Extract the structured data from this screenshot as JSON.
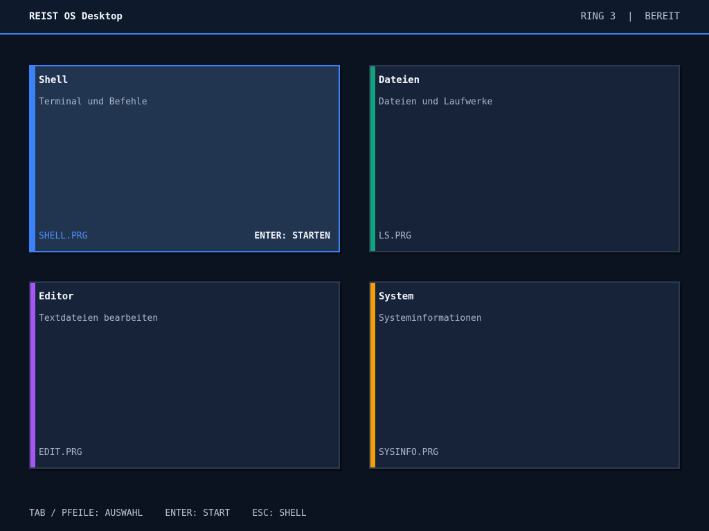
{
  "topbar": {
    "title": "REIST OS Desktop",
    "status": "RING 3  |  BEREIT"
  },
  "tiles": [
    {
      "name": "Shell",
      "description": "Terminal und Befehle",
      "file": "SHELL.PRG",
      "hint": "ENTER: STARTEN",
      "accent": "#3b82f6",
      "selected": true
    },
    {
      "name": "Dateien",
      "description": "Dateien und Laufwerke",
      "file": "LS.PRG",
      "accent": "#10a37f",
      "selected": false
    },
    {
      "name": "Editor",
      "description": "Textdateien bearbeiten",
      "file": "EDIT.PRG",
      "accent": "#a855f7",
      "selected": false
    },
    {
      "name": "System",
      "description": "Systeminformationen",
      "file": "SYSINFO.PRG",
      "accent": "#f59e0b",
      "selected": false
    }
  ],
  "footer": {
    "hint_select": "TAB / PFEILE: AUSWAHL",
    "hint_start": "ENTER: START",
    "hint_escape": "ESC: SHELL"
  }
}
